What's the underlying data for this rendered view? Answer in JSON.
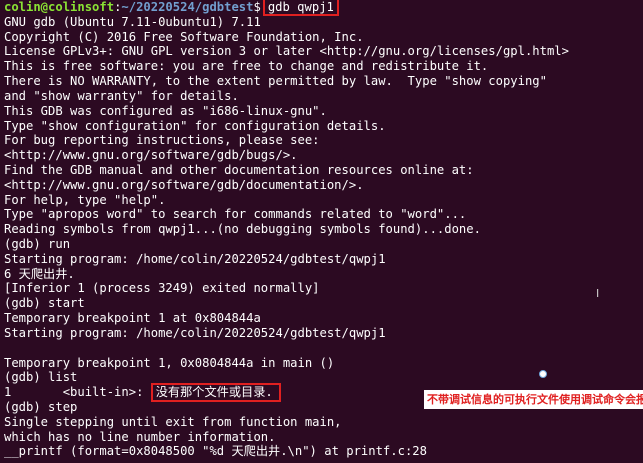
{
  "prompt": {
    "user_host": "colin@colinsoft",
    "separator": ":",
    "path": "~/20220524/gdbtest",
    "dollar": "$",
    "command": "gdb qwpj1"
  },
  "lines": [
    "GNU gdb (Ubuntu 7.11-0ubuntu1) 7.11",
    "Copyright (C) 2016 Free Software Foundation, Inc.",
    "License GPLv3+: GNU GPL version 3 or later <http://gnu.org/licenses/gpl.html>",
    "This is free software: you are free to change and redistribute it.",
    "There is NO WARRANTY, to the extent permitted by law.  Type \"show copying\"",
    "and \"show warranty\" for details.",
    "This GDB was configured as \"i686-linux-gnu\".",
    "Type \"show configuration\" for configuration details.",
    "For bug reporting instructions, please see:",
    "<http://www.gnu.org/software/gdb/bugs/>.",
    "Find the GDB manual and other documentation resources online at:",
    "<http://www.gnu.org/software/gdb/documentation/>.",
    "For help, type \"help\".",
    "Type \"apropos word\" to search for commands related to \"word\"...",
    "Reading symbols from qwpj1...(no debugging symbols found)...done.",
    "(gdb) run",
    "Starting program: /home/colin/20220524/gdbtest/qwpj1",
    "6 天爬出井.",
    "[Inferior 1 (process 3249) exited normally]",
    "(gdb) start",
    "Temporary breakpoint 1 at 0x804844a",
    "Starting program: /home/colin/20220524/gdbtest/qwpj1",
    "",
    "Temporary breakpoint 1, 0x0804844a in main ()",
    "(gdb) list"
  ],
  "list_line": {
    "prefix": "1       <built-in>: ",
    "error": "没有那个文件或目录."
  },
  "lines_after": [
    "(gdb) step",
    "Single stepping until exit from function main,",
    "which has no line number information.",
    "__printf (format=0x8048500 \"%d 天爬出井.\\n\") at printf.c:28"
  ],
  "annotation": "不带调试信息的可执行文件使用调试命令会报错",
  "cursor_glyph": "I",
  "colors": {
    "background": "#2c0a22",
    "text": "#ffffff",
    "prompt_user": "#8ae234",
    "prompt_path": "#729fcf",
    "highlight_box": "#e02020",
    "annotation_text": "#e02020"
  }
}
